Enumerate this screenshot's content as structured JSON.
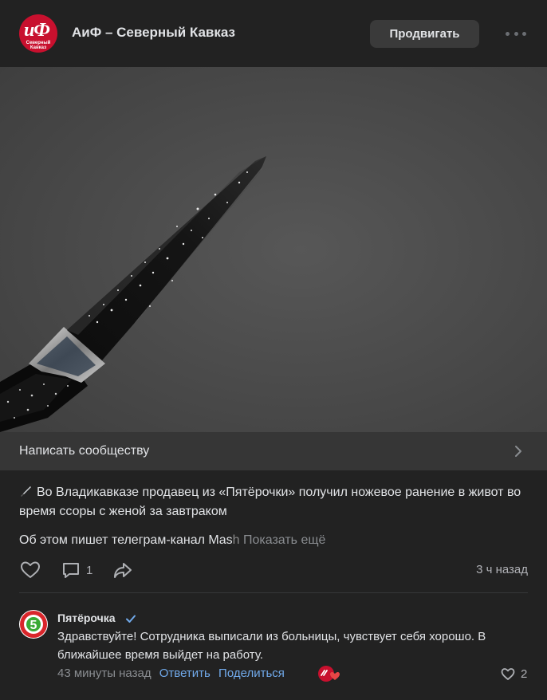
{
  "header": {
    "avatar_text": "иФ",
    "avatar_subtext": "Северный Кавказ",
    "title": "АиФ – Северный Кавказ",
    "promote_label": "Продвигать",
    "more_icon": "more-horizontal-icon"
  },
  "write_bar": {
    "label": "Написать сообществу",
    "icon": "chevron-right-icon"
  },
  "post": {
    "text": "Во Владикавказе продавец из «Пятёрочки» получил ножевое ранение в живот во время ссоры с женой за завтраком",
    "sub_visible": "Об этом пишет телеграм-канал Mas",
    "sub_faded": "h",
    "show_more": "Показать ещё",
    "actions": {
      "like_icon": "heart-icon",
      "comment_icon": "comment-icon",
      "comment_count": "1",
      "share_icon": "share-icon",
      "time": "3 ч назад"
    }
  },
  "comment": {
    "author": "Пятёрочка",
    "avatar_text": "5",
    "text": "Здравствуйте! Сотрудника выписали из больницы, чувствует себя хорошо. В ближайшее время выйдет на работу.",
    "time": "43 минуты назад",
    "reply_label": "Ответить",
    "share_label": "Поделиться",
    "like_count": "2"
  },
  "colors": {
    "background": "#222222",
    "text": "#e1e3e6",
    "secondary": "#8a8d91",
    "link": "#71aaeb",
    "brand_red": "#c8102e"
  }
}
